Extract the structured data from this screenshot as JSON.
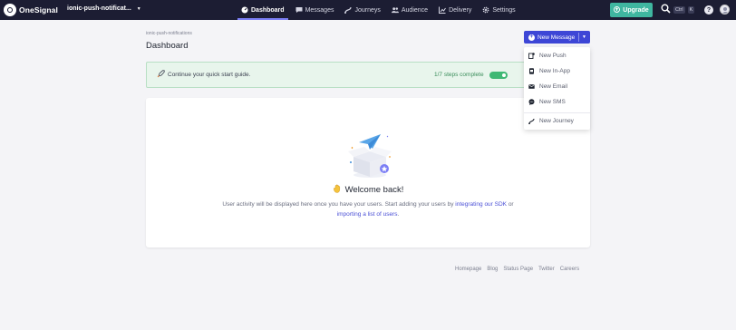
{
  "app": {
    "logo_text": "OneSignal",
    "app_name": "ionic-push-notificat...",
    "colors": {
      "topbar": "#1c1d33",
      "primary": "#3d46d6",
      "upgrade": "#3fb6a0",
      "success": "#3fb874"
    }
  },
  "nav": {
    "items": [
      {
        "label": "Dashboard",
        "icon": "gauge-icon",
        "active": true
      },
      {
        "label": "Messages",
        "icon": "message-icon",
        "active": false
      },
      {
        "label": "Journeys",
        "icon": "journey-icon",
        "active": false
      },
      {
        "label": "Audience",
        "icon": "users-icon",
        "active": false
      },
      {
        "label": "Delivery",
        "icon": "chart-icon",
        "active": false
      },
      {
        "label": "Settings",
        "icon": "gear-icon",
        "active": false
      }
    ],
    "upgrade_label": "Upgrade",
    "shortcut_ctrl": "Ctrl",
    "shortcut_key": "K",
    "help_label": "?"
  },
  "header": {
    "breadcrumb": "ionic-push-notifications",
    "title": "Dashboard",
    "new_message_label": "New Message"
  },
  "quickstart": {
    "text": "Continue your quick start guide.",
    "steps": "1/7 steps complete",
    "progress": 0.14
  },
  "welcome": {
    "title": "Welcome back!",
    "desc_before": "User activity will be displayed here once you have your users. Start adding your users by ",
    "link1": "integrating our SDK",
    "desc_mid": " or",
    "link2": "importing a list of users",
    "desc_end": "."
  },
  "dropdown": {
    "items": [
      {
        "label": "New Push",
        "icon": "push-icon"
      },
      {
        "label": "New In-App",
        "icon": "in-app-icon"
      },
      {
        "label": "New Email",
        "icon": "email-icon"
      },
      {
        "label": "New SMS",
        "icon": "sms-icon"
      },
      {
        "label": "New Journey",
        "icon": "journey-icon"
      }
    ]
  },
  "footer": {
    "links": [
      "Homepage",
      "Blog",
      "Status Page",
      "Twitter",
      "Careers"
    ]
  }
}
